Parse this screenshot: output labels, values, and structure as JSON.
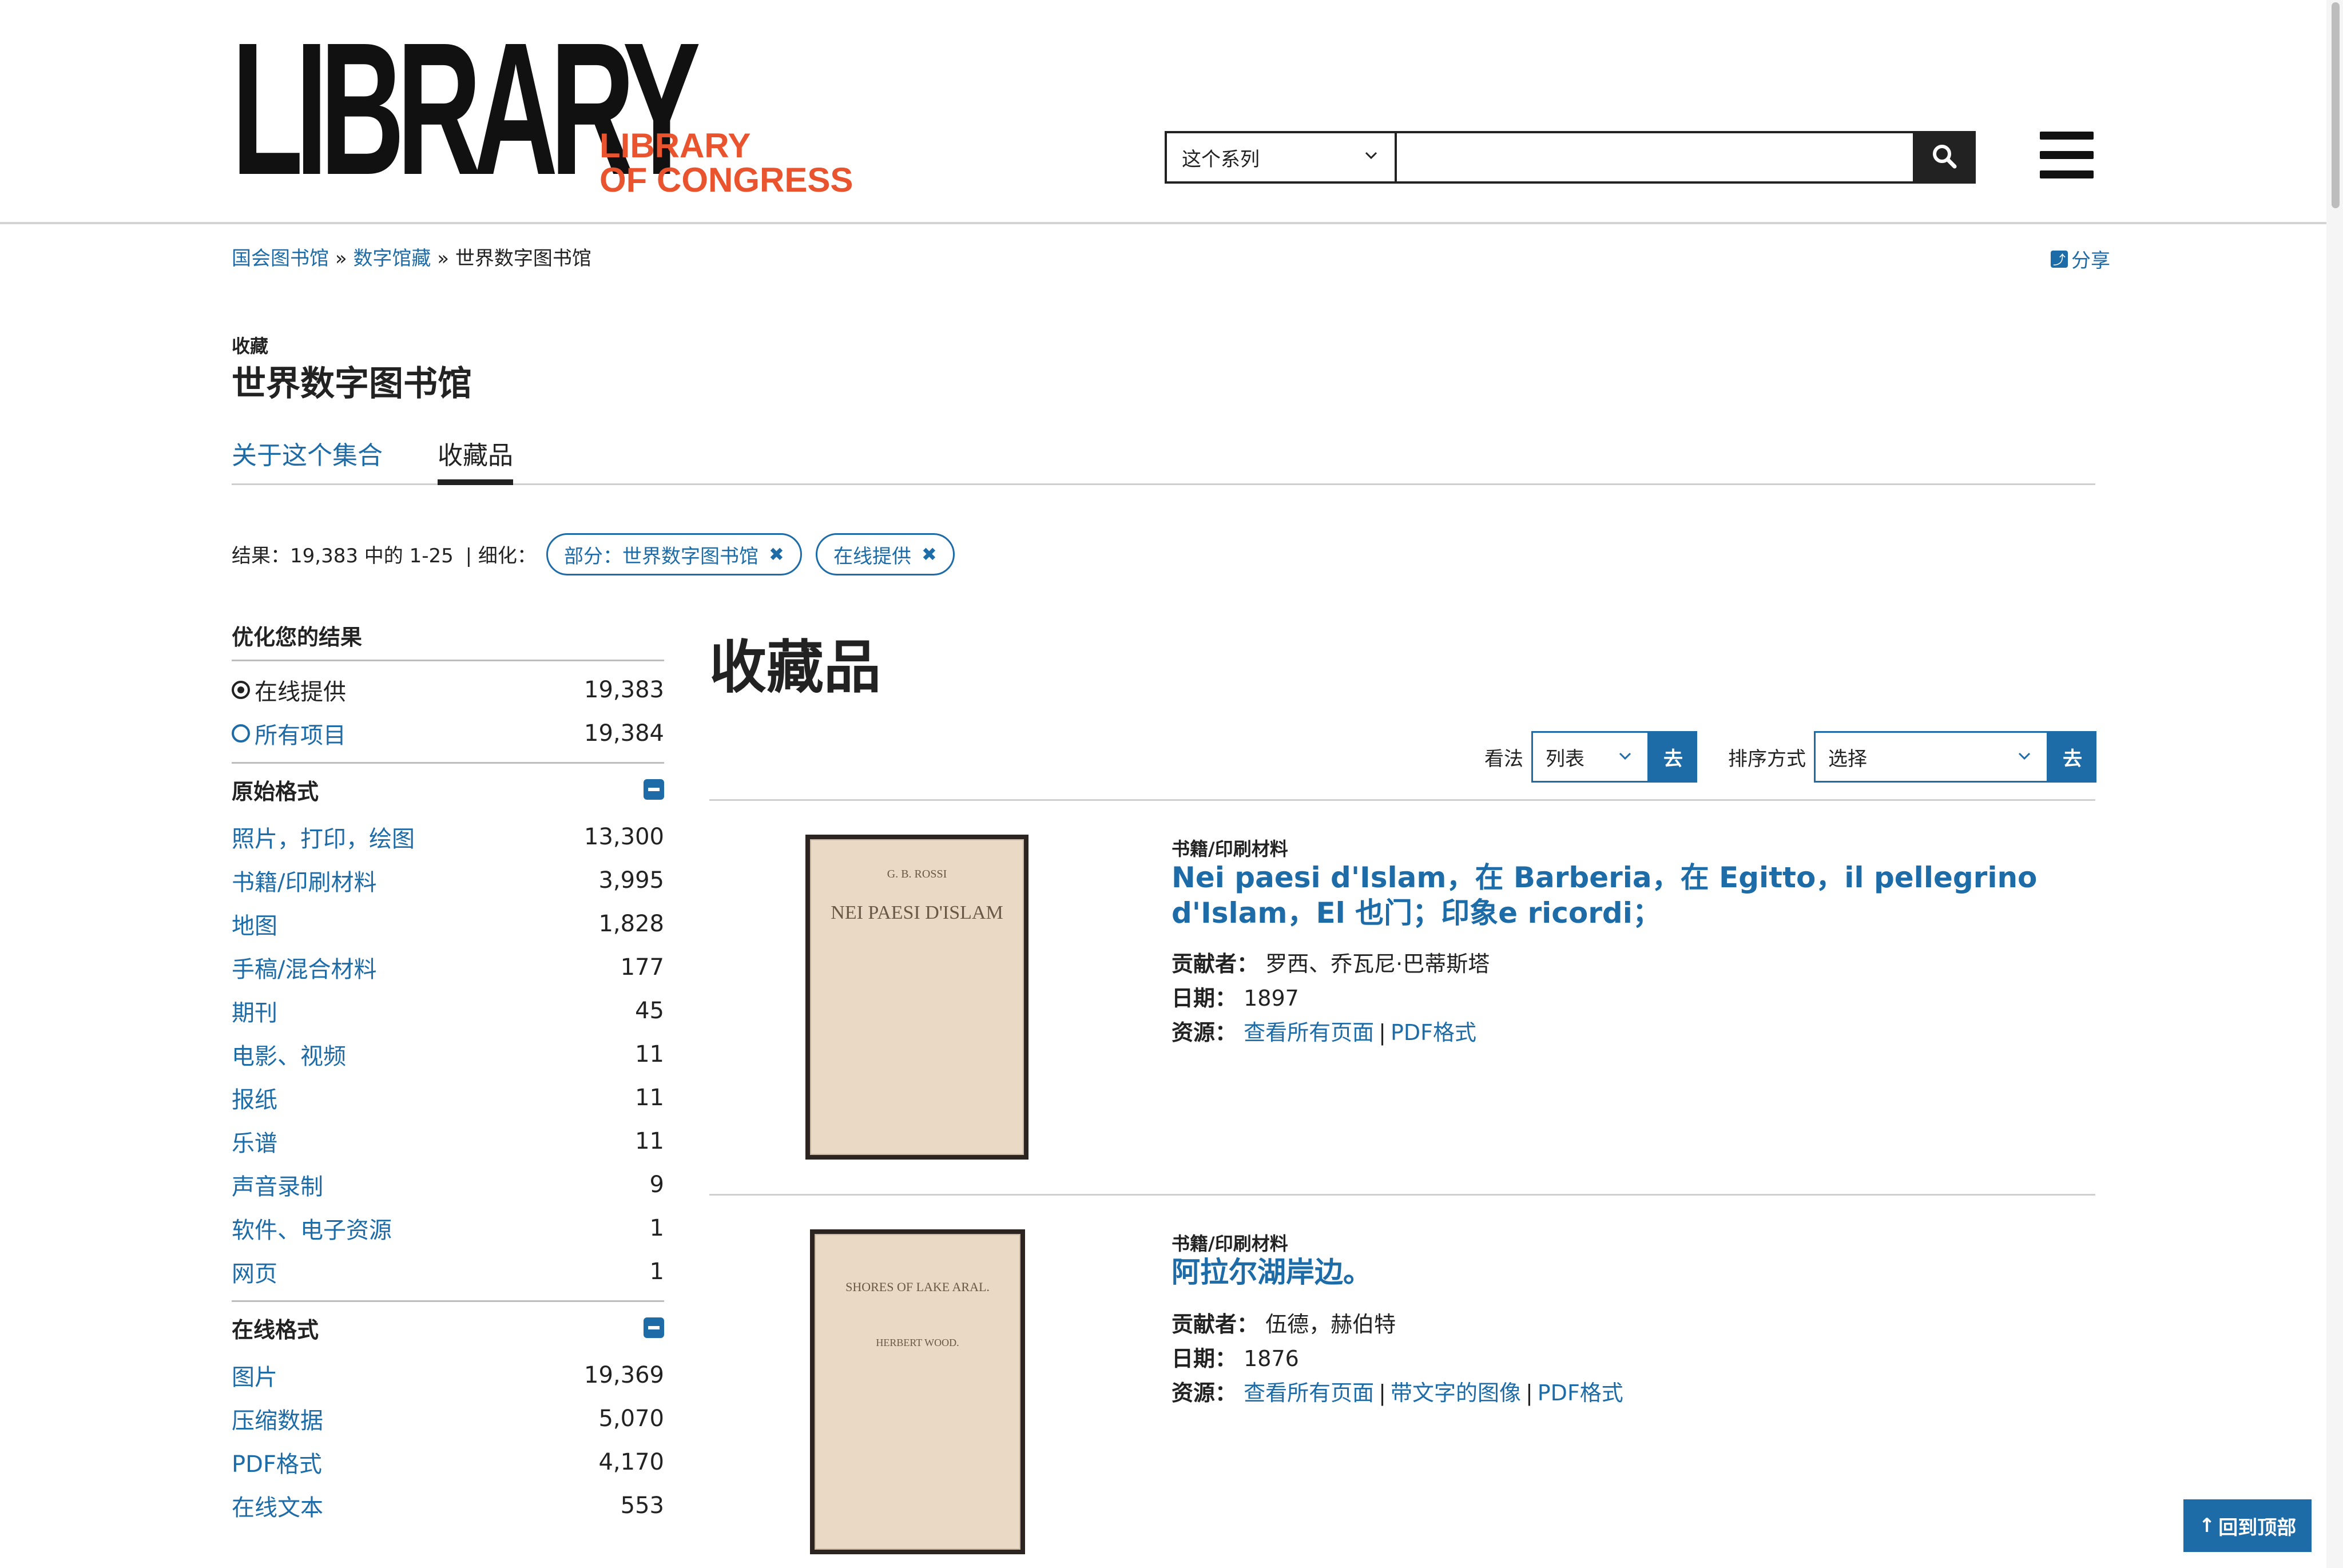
{
  "header": {
    "logo_main": "LIBRARY",
    "logo_sub_line1": "LIBRARY",
    "logo_sub_line2": "OF CONGRESS",
    "search_scope": "这个系列",
    "search_placeholder": "",
    "search_icon": "search-icon",
    "menu_icon": "hamburger-menu-icon"
  },
  "breadcrumb": {
    "items": [
      "国会图书馆",
      "数字馆藏",
      "世界数字图书馆"
    ],
    "separator": "»"
  },
  "share_label": "分享",
  "collection": {
    "label": "收藏",
    "title": "世界数字图书馆"
  },
  "tabs": [
    {
      "label": "关于这个集合",
      "active": false
    },
    {
      "label": "收藏品",
      "active": true
    }
  ],
  "results_summary": "结果：19,383 中的 1-25",
  "refine_label": "| 细化：",
  "chips": [
    {
      "label": "部分：世界数字图书馆",
      "remove": "✖"
    },
    {
      "label": "在线提供",
      "remove": "✖"
    }
  ],
  "sidebar": {
    "title": "优化您的结果",
    "availability": [
      {
        "label": "在线提供",
        "count": "19,383",
        "selected": true
      },
      {
        "label": "所有项目",
        "count": "19,384",
        "selected": false
      }
    ],
    "original_format": {
      "title": "原始格式",
      "items": [
        {
          "label": "照片，打印，绘图",
          "count": "13,300"
        },
        {
          "label": "书籍/印刷材料",
          "count": "3,995"
        },
        {
          "label": "地图",
          "count": "1,828"
        },
        {
          "label": "手稿/混合材料",
          "count": "177"
        },
        {
          "label": "期刊",
          "count": "45"
        },
        {
          "label": "电影、视频",
          "count": "11"
        },
        {
          "label": "报纸",
          "count": "11"
        },
        {
          "label": "乐谱",
          "count": "11"
        },
        {
          "label": "声音录制",
          "count": "9"
        },
        {
          "label": "软件、电子资源",
          "count": "1"
        },
        {
          "label": "网页",
          "count": "1"
        }
      ]
    },
    "online_format": {
      "title": "在线格式",
      "items": [
        {
          "label": "图片",
          "count": "19,369"
        },
        {
          "label": "压缩数据",
          "count": "5,070"
        },
        {
          "label": "PDF格式",
          "count": "4,170"
        },
        {
          "label": "在线文本",
          "count": "553"
        }
      ]
    }
  },
  "main": {
    "title": "收藏品",
    "view_label": "看法",
    "view_value": "列表",
    "go_label": "去",
    "sort_label": "排序方式",
    "sort_value": "选择"
  },
  "results": [
    {
      "kind": "书籍/印刷材料",
      "title": "Nei paesi d'Islam，在 Barberia，在 Egitto，il pellegrino d'Islam，El 也门；印象e ricordi；",
      "contributor_label": "贡献者：",
      "contributor": "罗西、乔瓦尼·巴蒂斯塔",
      "date_label": "日期：",
      "date": "1897",
      "resources_label": "资源：",
      "resources": [
        "查看所有页面",
        "PDF格式"
      ],
      "thumb_lines": [
        "G. B. ROSSI",
        "NEI PAESI D'ISLAM"
      ]
    },
    {
      "kind": "书籍/印刷材料",
      "title": "阿拉尔湖岸边。",
      "contributor_label": "贡献者：",
      "contributor": "伍德，赫伯特",
      "date_label": "日期：",
      "date": "1876",
      "resources_label": "资源：",
      "resources": [
        "查看所有页面",
        "带文字的图像",
        "PDF格式"
      ],
      "thumb_lines": [
        "SHORES OF LAKE ARAL.",
        "HERBERT WOOD."
      ]
    }
  ],
  "back_to_top": "回到顶部",
  "colors": {
    "link": "#1d6ca8",
    "brand_orange": "#e9542f",
    "text": "#222222"
  }
}
